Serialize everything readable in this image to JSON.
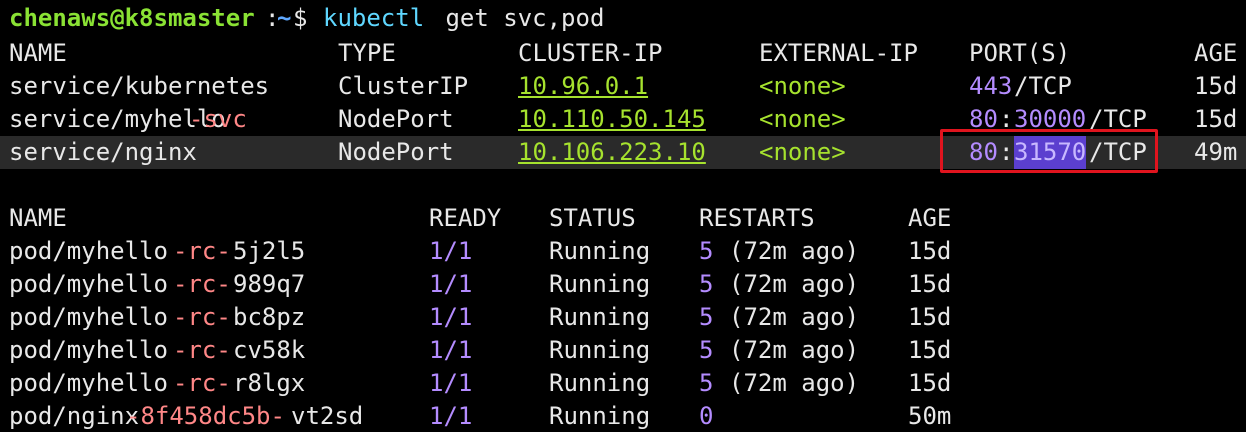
{
  "terminal": {
    "prompt": {
      "user_host": "chenaws@k8smaster",
      "separator": ":",
      "path": "~",
      "symbol": "$",
      "command": "kubectl",
      "args": " get svc,pod"
    },
    "svc_headers": [
      "NAME",
      "TYPE",
      "CLUSTER-IP",
      "EXTERNAL-IP",
      "PORT(S)",
      "AGE"
    ],
    "services": [
      {
        "name_a": "service/kubernetes",
        "name_b": "",
        "type": "ClusterIP",
        "cluster_ip": "10.96.0.1",
        "external_ip": "<none>",
        "port_a": "443",
        "port_b": "",
        "port_c": "/TCP",
        "age": "15d"
      },
      {
        "name_a": "service/myhello",
        "name_b": "-svc",
        "type": "NodePort",
        "cluster_ip": "10.110.50.145",
        "external_ip": "<none>",
        "port_a": "80",
        "port_b": "30000",
        "port_c": "/TCP",
        "age": "15d"
      },
      {
        "name_a": "service/nginx",
        "name_b": "",
        "type": "NodePort",
        "cluster_ip": "10.106.223.10",
        "external_ip": "<none>",
        "port_a": "80",
        "port_b": "31570",
        "port_c": "/TCP",
        "age": "49m"
      }
    ],
    "pod_headers": [
      "NAME",
      "READY",
      "STATUS",
      "RESTARTS",
      "AGE"
    ],
    "pods": [
      {
        "name_a": "pod/myhello",
        "name_b": "-rc-",
        "name_c": "5j2l5",
        "ready": "1/1",
        "status": "Running",
        "restarts": "5",
        "restarts_note": "(72m ago)",
        "age": "15d"
      },
      {
        "name_a": "pod/myhello",
        "name_b": "-rc-",
        "name_c": "989q7",
        "ready": "1/1",
        "status": "Running",
        "restarts": "5",
        "restarts_note": "(72m ago)",
        "age": "15d"
      },
      {
        "name_a": "pod/myhello",
        "name_b": "-rc-",
        "name_c": "bc8pz",
        "ready": "1/1",
        "status": "Running",
        "restarts": "5",
        "restarts_note": "(72m ago)",
        "age": "15d"
      },
      {
        "name_a": "pod/myhello",
        "name_b": "-rc-",
        "name_c": "cv58k",
        "ready": "1/1",
        "status": "Running",
        "restarts": "5",
        "restarts_note": "(72m ago)",
        "age": "15d"
      },
      {
        "name_a": "pod/myhello",
        "name_b": "-rc-",
        "name_c": "r8lgx",
        "ready": "1/1",
        "status": "Running",
        "restarts": "5",
        "restarts_note": "(72m ago)",
        "age": "15d"
      },
      {
        "name_a": "pod/nginx",
        "name_b": "-8f458dc5b-",
        "name_c": "vt2sd",
        "ready": "1/1",
        "status": "Running",
        "restarts": "0",
        "restarts_note": "",
        "age": "50m"
      }
    ],
    "colors": {
      "user_host": "#8ae234",
      "path": "#5fa8ff",
      "command": "#5fd7ff",
      "ip": "#a6e22e",
      "number": "#b48cff",
      "dash": "#ff8787",
      "highlight_box": "#e0141e",
      "selection": "#5b3fcf"
    }
  }
}
